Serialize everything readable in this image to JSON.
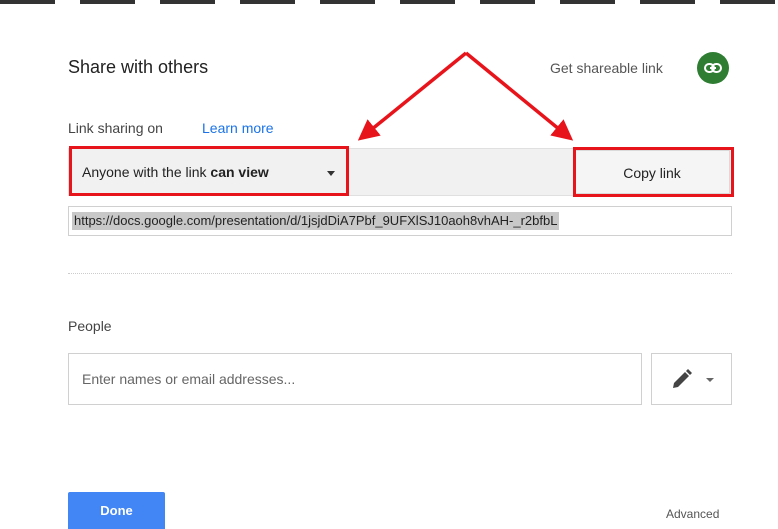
{
  "dialog": {
    "title": "Share with others",
    "get_shareable_link": "Get shareable link",
    "link_icon": "link-icon"
  },
  "link_sharing": {
    "status_label": "Link sharing on",
    "learn_more": "Learn more",
    "access_prefix": "Anyone with the link",
    "access_level": "can view",
    "copy_link": "Copy link",
    "url": "https://docs.google.com/presentation/d/1jsjdDiA7Pbf_9UFXlSJ10aoh8vhAH-_r2bfbL"
  },
  "people": {
    "label": "People",
    "placeholder": "Enter names or email addresses...",
    "permission_icon": "pencil-icon"
  },
  "footer": {
    "done": "Done",
    "advanced": "Advanced"
  },
  "colors": {
    "accent_blue": "#4285f4",
    "link_blue": "#1a73e8",
    "annotation_red": "#e8141b",
    "link_icon_green": "#2e7d32"
  }
}
